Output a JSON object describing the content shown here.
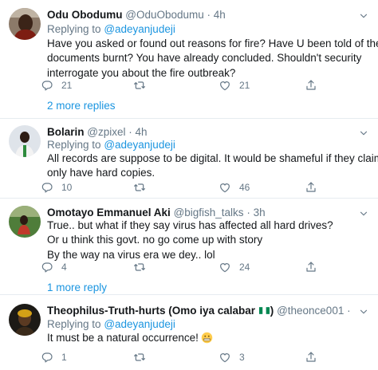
{
  "tweets": [
    {
      "name": "Odu Obodumu",
      "handle": "@OduObodumu",
      "dot": "·",
      "time": "4h",
      "replying_prefix": "Replying to",
      "replying_to": "@adeyanjudeji",
      "lines": [
        "Have you asked or found out reasons for fire? Have U been told of the",
        "documents burnt? You have already concluded. Shouldn't security",
        "interrogate you about the fire outbreak?"
      ],
      "reply_count": "21",
      "retweet_count": "",
      "like_count": "21",
      "more_replies": "2 more replies"
    },
    {
      "name": "Bolarin",
      "handle": "@zpixel",
      "dot": "·",
      "time": "4h",
      "replying_prefix": "Replying to",
      "replying_to": "@adeyanjudeji",
      "lines": [
        "All records are suppose to be digital. It would be shameful if they claim to",
        "only have hard copies."
      ],
      "reply_count": "10",
      "retweet_count": "",
      "like_count": "46"
    },
    {
      "name": "Omotayo Emmanuel Aki",
      "handle": "@bigfish_talks",
      "dot": "·",
      "time": "3h",
      "lines": [
        "True.. but what if they say virus has affected all hard drives?",
        "Or u think this govt. no go come up with story",
        "By the way na virus era we dey.. lol"
      ],
      "reply_count": "4",
      "retweet_count": "",
      "like_count": "24",
      "more_replies": "1 more reply"
    },
    {
      "name_before_flag": "Theophilus-Truth-hurts (Omo iya calabar",
      "name_after_flag": ")",
      "handle": "@theonce001",
      "dot": "·",
      "time": "4h",
      "replying_prefix": "Replying to",
      "replying_to": "@adeyanjudeji",
      "lines": [
        "It must be a natural occurrence!"
      ],
      "reply_count": "1",
      "retweet_count": "",
      "like_count": "3"
    }
  ],
  "icons": {
    "reply": "reply-icon",
    "retweet": "retweet-icon",
    "like": "heart-icon",
    "share": "share-icon",
    "caret": "chevron-down-icon"
  },
  "colors": {
    "link": "#1b95e0",
    "muted": "#657786",
    "text": "#14171a",
    "divider": "#e6ecf0"
  }
}
